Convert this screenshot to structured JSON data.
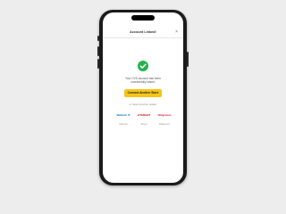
{
  "modal": {
    "title": "Account Linked!",
    "close_symbol": "×"
  },
  "status": {
    "message": "Your CVS account has been successfully linked."
  },
  "actions": {
    "primary_label": "Connect Another Store",
    "sub_label": "or Select Another retailer"
  },
  "stores": [
    {
      "logo": "Walmart ✳",
      "label": "Walmart",
      "color": "#0071ce"
    },
    {
      "logo": "⊙TARGET",
      "label": "Target",
      "color": "#cc0000"
    },
    {
      "logo": "Walgreens",
      "label": "Walgreens",
      "color": "#e31837"
    }
  ],
  "colors": {
    "success": "#22b34a",
    "accent": "#f5c518",
    "background": "#ededed"
  }
}
